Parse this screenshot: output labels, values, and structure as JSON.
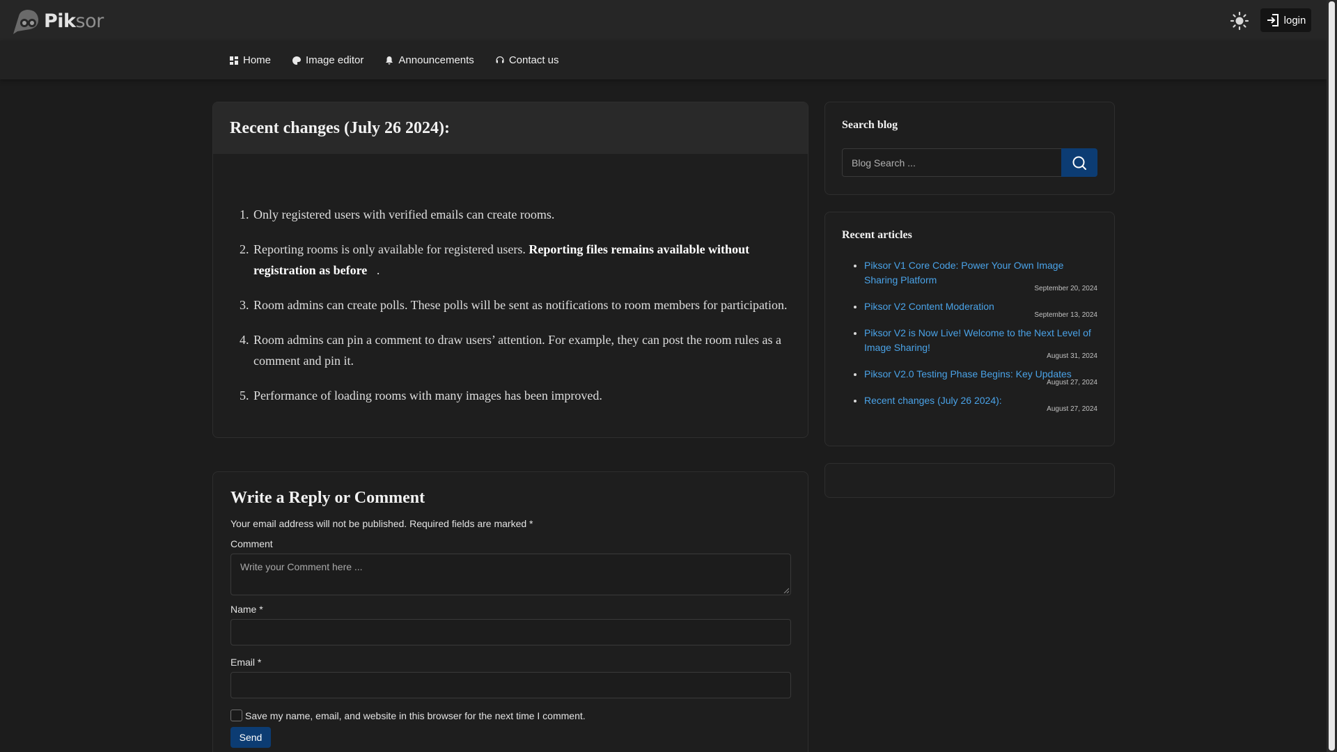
{
  "header": {
    "logo_text_bold": "Pik",
    "logo_text_light": "sor",
    "login_label": "login",
    "theme_icon": "sun-icon",
    "login_icon": "login-icon"
  },
  "nav": {
    "items": [
      {
        "label": "Home",
        "icon": "dashboard-icon"
      },
      {
        "label": "Image editor",
        "icon": "palette-icon"
      },
      {
        "label": "Announcements",
        "icon": "bell-icon"
      },
      {
        "label": "Contact us",
        "icon": "headset-icon"
      }
    ]
  },
  "post": {
    "title": "Recent changes (July 26 2024):",
    "items": [
      "Only registered users with verified emails can create rooms.",
      "Reporting rooms is only available for registered users.",
      "Room admins can create polls. These polls will be sent as notifications to room members for participation.",
      "Room admins can pin a comment to draw users’ attention. For example, they can post the room rules as a comment and pin it.",
      "Performance of loading rooms with many images has been improved."
    ],
    "item2_bold": "Reporting files remains available without registration as before",
    "item2_tail": "."
  },
  "comment_form": {
    "title": "Write a Reply or Comment",
    "notice": "Your email address will not be published. Required fields are marked *",
    "comment_label": "Comment",
    "comment_placeholder": "Write your Comment here ...",
    "name_label": "Name *",
    "email_label": "Email *",
    "save_label": "Save my name, email, and website in this browser for the next time I comment.",
    "send_label": "Send"
  },
  "sidebar": {
    "search_title": "Search blog",
    "search_placeholder": "Blog Search ...",
    "recent_title": "Recent articles",
    "articles": [
      {
        "title": "Piksor V1 Core Code: Power Your Own Image Sharing Platform",
        "date": "September 20, 2024"
      },
      {
        "title": "Piksor V2 Content Moderation",
        "date": "September 13, 2024"
      },
      {
        "title": "Piksor V2 is Now Live! Welcome to the Next Level of Image Sharing!",
        "date": "August 31, 2024"
      },
      {
        "title": "Piksor V2.0 Testing Phase Begins: Key Updates",
        "date": "August 27, 2024"
      },
      {
        "title": "Recent changes (July 26 2024):",
        "date": "August 27, 2024"
      }
    ]
  },
  "colors": {
    "background": "#1c1c1c",
    "topbar": "#262626",
    "accent_button": "#0c3c73",
    "link": "#4aa3e8"
  }
}
